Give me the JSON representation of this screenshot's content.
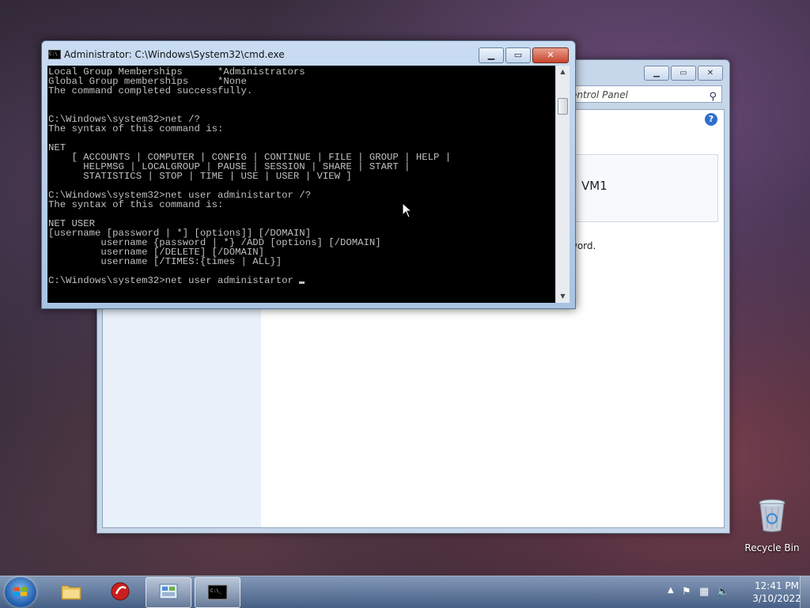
{
  "control_panel": {
    "address_text": "ontrol Panel",
    "card_label": "VM1",
    "body_text": "word."
  },
  "cmd": {
    "title": "Administrator: C:\\Windows\\System32\\cmd.exe",
    "lines": [
      "Local Group Memberships      *Administrators",
      "Global Group memberships     *None",
      "The command completed successfully.",
      "",
      "",
      "C:\\Windows\\system32>net /?",
      "The syntax of this command is:",
      "",
      "NET",
      "    [ ACCOUNTS | COMPUTER | CONFIG | CONTINUE | FILE | GROUP | HELP |",
      "      HELPMSG | LOCALGROUP | PAUSE | SESSION | SHARE | START |",
      "      STATISTICS | STOP | TIME | USE | USER | VIEW ]",
      "",
      "C:\\Windows\\system32>net user administartor /?",
      "The syntax of this command is:",
      "",
      "NET USER",
      "[username [password | *] [options]] [/DOMAIN]",
      "         username {password | *} /ADD [options] [/DOMAIN]",
      "         username [/DELETE] [/DOMAIN]",
      "         username [/TIMES:{times | ALL}]",
      ""
    ],
    "current_input": "C:\\Windows\\system32>net user administartor "
  },
  "desktop": {
    "recycle_bin_label": "Recycle Bin"
  },
  "taskbar": {
    "clock_time": "12:41 PM",
    "clock_date": "3/10/2022",
    "items": [
      "windows-explorer",
      "media-app",
      "control-panel",
      "command-prompt"
    ]
  },
  "colors": {
    "console_bg": "#000000",
    "console_fg": "#c0c0c0",
    "close_button": "#c7442c"
  }
}
